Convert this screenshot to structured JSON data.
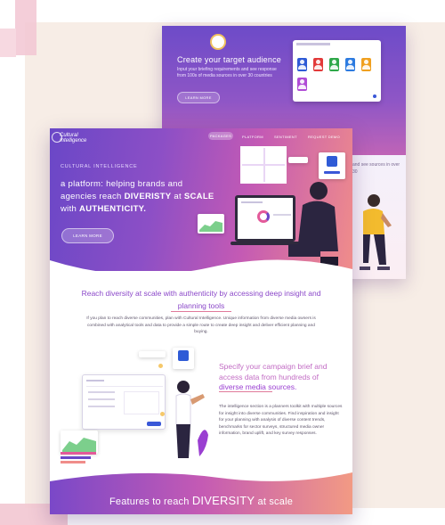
{
  "back_page": {
    "title": "Create your target audience",
    "description": "Input your briefing requirements and see response from 100s of media sources in over 30 countries",
    "button_label": "LEARN MORE",
    "side_text": "and see sources in over 30",
    "avatar_colors": [
      "#2f5bd6",
      "#e23a3a",
      "#2fa84a",
      "#2d7be0",
      "#f0a020",
      "#b04cd6"
    ]
  },
  "front_page": {
    "logo_line1": "Cultural",
    "logo_line2": "Intelligence",
    "nav": [
      "PACKAGES",
      "PLATFORM",
      "SENTIMENT",
      "REQUEST DEMO"
    ],
    "kicker": "CULTURAL INTELLIGENCE",
    "hero_title_1": "a platform: helping brands and",
    "hero_title_2": "agencies reach ",
    "hero_title_bold1": "DIVERISTY",
    "hero_title_3": " at",
    "hero_title_bold2": "SCALE",
    "hero_title_4": " with ",
    "hero_title_bold3": "AUTHENTICITY.",
    "hero_button": "LEARN MORE",
    "headline": "Reach diversity at scale with authenticity by accessing deep insight and planning tools",
    "body": "If you plan to reach diverse communities, plan with Cultural Intelligence. Unique information from diverse media owners is combined with analytical tools and data to provide a simple route to create deep insight and deliver efficient planning and buying.",
    "spec_title_1": "Specify your campaign brief and access data from hundreds of ",
    "spec_title_bold": "diverse media sources.",
    "spec_body": "The intelligence section is a planners toolkit with multiple sources for insight into diverse communities. Find inspiration and insight for your planning with analysis of diverse content trends, benchmarks for sector surveys, structured media owner information, brand uplift, and key survey responses.",
    "footer_title_1": "Features to reach ",
    "footer_title_bold": "DIVERSITY",
    "footer_title_2": " at scale"
  },
  "colors": {
    "purple": "#6a47c7",
    "magenta": "#c45ab4",
    "coral": "#f08d8a",
    "accent_line": "#e07a9a"
  }
}
